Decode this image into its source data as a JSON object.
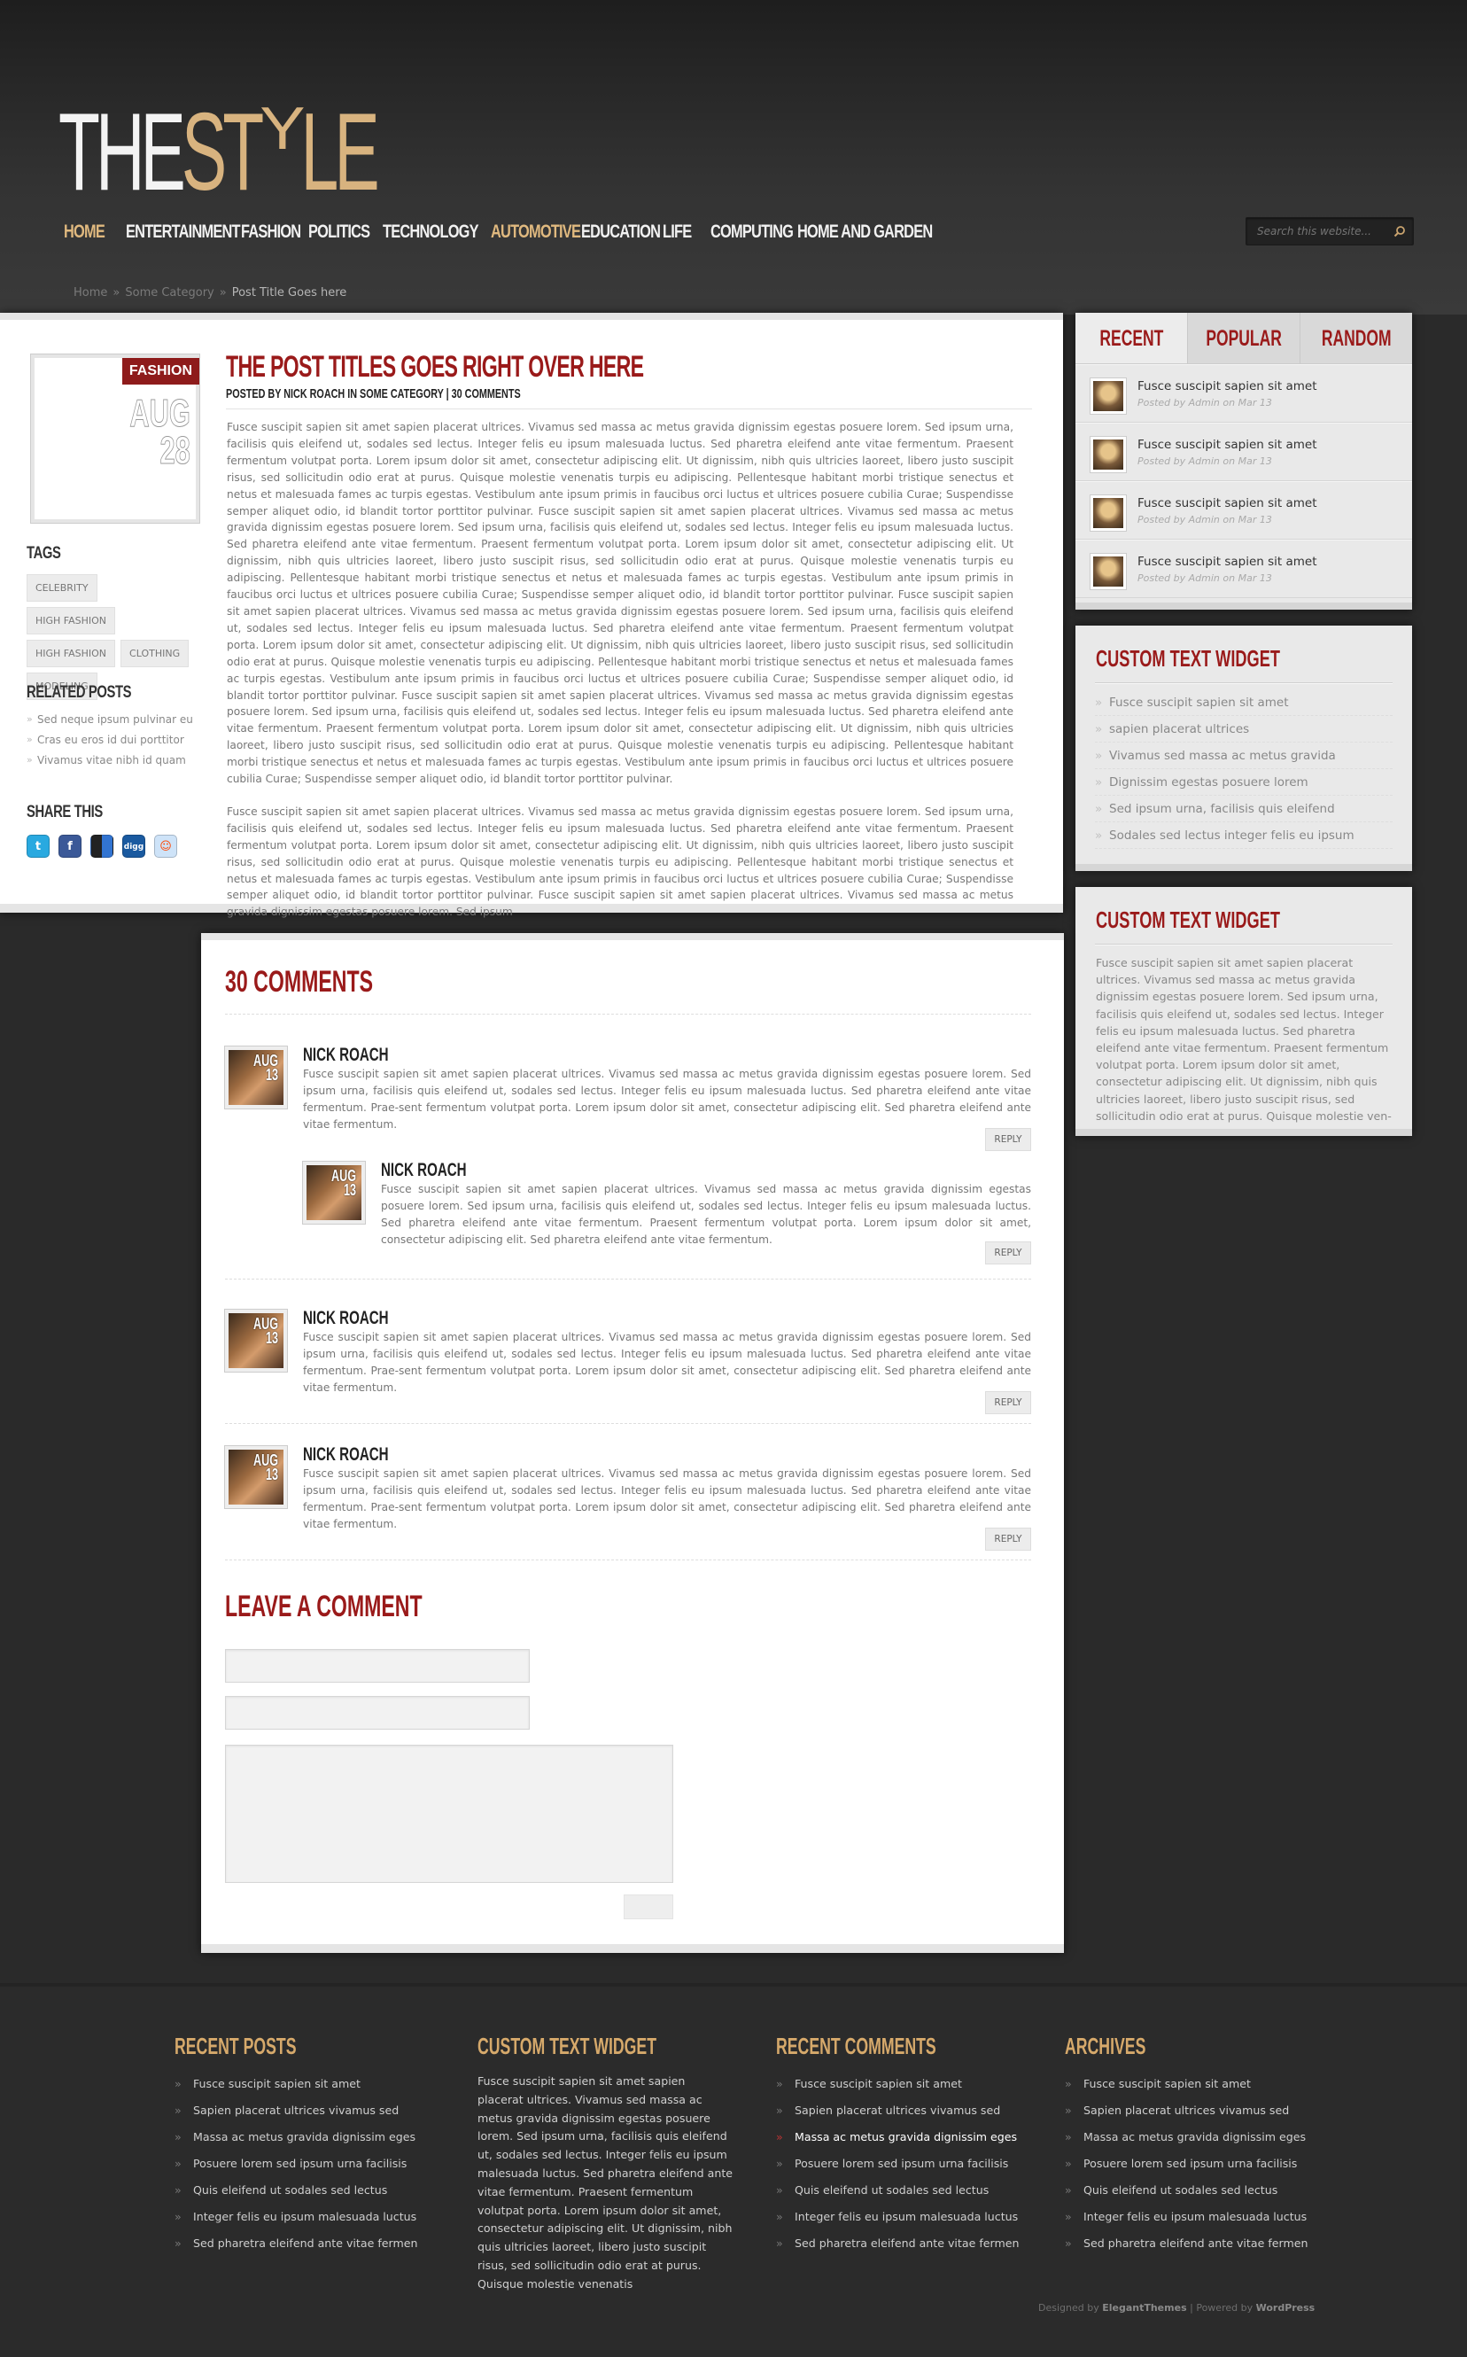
{
  "header": {
    "logo_part1": "THE",
    "logo_part2": "ST",
    "logo_part3": "Y",
    "logo_part4": "LE",
    "search_placeholder": "Search this website...",
    "nav": [
      {
        "label": "Home",
        "active": true
      },
      {
        "label": "Entertainment"
      },
      {
        "label": "Fashion"
      },
      {
        "label": "Politics"
      },
      {
        "label": "Technology"
      },
      {
        "label": "Automotive",
        "active": true
      },
      {
        "label": "Education"
      },
      {
        "label": "Life"
      },
      {
        "label": "Computing"
      },
      {
        "label": "Home and Garden"
      }
    ],
    "colors": {
      "gold": "#e0b97f",
      "red": "#9a1a1a"
    }
  },
  "breadcrumb": {
    "home": "Home",
    "category": "Some Category",
    "current": "Post Title Goes here",
    "sep": "»"
  },
  "post": {
    "category": "Fashion",
    "month": "AUG",
    "day": "28",
    "title": "The Post Titles Goes Right Over Here",
    "meta": "Posted by Nick Roach in Some Category | 30 Comments",
    "p1": "Fusce suscipit sapien sit amet sapien placerat ultrices. Vivamus sed massa ac metus gravida dignissim egestas posuere lorem. Sed ipsum urna, facilisis quis eleifend ut, sodales sed lectus. Integer felis eu ipsum malesuada luctus. Sed pharetra eleifend ante vitae fermentum. Praesent fermentum volutpat porta. Lorem ipsum dolor sit amet, consectetur adipiscing elit. Ut dignissim, nibh quis ultricies laoreet, libero justo suscipit risus, sed sollicitudin odio erat at purus. Quisque molestie venenatis turpis eu adipiscing. Pellentesque habitant morbi tristique senectus et netus et malesuada fames ac turpis egestas. Vestibulum ante ipsum primis in faucibus orci luctus et ultrices posuere cubilia Curae; Suspendisse semper aliquet odio, id blandit tortor porttitor pulvinar. Fusce suscipit sapien sit amet sapien placerat ultrices. Vivamus sed massa ac metus gravida dignissim egestas posuere lorem. Sed ipsum urna, facilisis quis eleifend ut, sodales sed lectus. Integer felis eu ipsum malesuada luctus. Sed pharetra eleifend ante vitae fermentum. Praesent fermentum volutpat porta. Lorem ipsum dolor sit amet, consectetur adipiscing elit. Ut dignissim, nibh quis ultricies laoreet, libero justo suscipit risus, sed sollicitudin odio erat at purus. Quisque molestie venenatis turpis eu adipiscing. Pellentesque habitant morbi tristique senectus et netus et malesuada fames ac turpis egestas. Vestibulum ante ipsum primis in faucibus orci luctus et ultrices posuere cubilia Curae; Suspendisse semper aliquet odio, id blandit tortor porttitor pulvinar. Fusce suscipit sapien sit amet sapien placerat ultrices. Vivamus sed massa ac metus gravida dignissim egestas posuere lorem. Sed ipsum urna, facilisis quis eleifend ut, sodales sed lectus. Integer felis eu ipsum malesuada luctus. Sed pharetra eleifend ante vitae fermentum. Praesent fermentum volutpat porta. Lorem ipsum dolor sit amet, consectetur adipiscing elit. Ut dignissim, nibh quis ultricies laoreet, libero justo suscipit risus, sed sollicitudin odio erat at purus. Quisque molestie venenatis turpis eu adipiscing. Pellentesque habitant morbi tristique senectus et netus et malesuada fames ac turpis egestas. Vestibulum ante ipsum primis in faucibus orci luctus et ultrices posuere cubilia Curae; Suspendisse semper aliquet odio, id blandit tortor porttitor pulvinar. Fusce suscipit sapien sit amet sapien placerat ultrices. Vivamus sed massa ac metus gravida dignissim egestas posuere lorem. Sed ipsum urna, facilisis quis eleifend ut, sodales sed lectus. Integer felis eu ipsum malesuada luctus. Sed pharetra eleifend ante vitae fermentum. Praesent fermentum volutpat porta. Lorem ipsum dolor sit amet, consectetur adipiscing elit. Ut dignissim, nibh quis ultricies laoreet, libero justo suscipit risus, sed sollicitudin odio erat at purus. Quisque molestie venenatis turpis eu adipiscing. Pellentesque habitant morbi tristique senectus et netus et malesuada fames ac turpis egestas. Vestibulum ante ipsum primis in faucibus orci luctus et ultrices posuere cubilia Curae; Suspendisse semper aliquet odio, id blandit tortor porttitor pulvinar.",
    "p2": "Fusce suscipit sapien sit amet sapien placerat ultrices. Vivamus sed massa ac metus gravida dignissim egestas posuere lorem. Sed ipsum urna, facilisis quis eleifend ut, sodales sed lectus. Integer felis eu ipsum malesuada luctus. Sed pharetra eleifend ante vitae fermentum. Praesent fermentum volutpat porta. Lorem ipsum dolor sit amet, consectetur adipiscing elit. Ut dignissim, nibh quis ultricies laoreet, libero justo suscipit risus, sed sollicitudin odio erat at purus. Quisque molestie venenatis turpis eu adipiscing. Pellentesque habitant morbi tristique senectus et netus et malesuada fames ac turpis egestas. Vestibulum ante ipsum primis in faucibus orci luctus et ultrices posuere cubilia Curae; Suspendisse semper aliquet odio, id blandit tortor porttitor pulvinar. Fusce suscipit sapien sit amet sapien placerat ultrices. Vivamus sed massa ac metus gravida dignissim egestas posuere lorem. Sed ipsum"
  },
  "left": {
    "tags_title": "Tags",
    "tags": [
      "Celebrity",
      "High Fashion",
      "High Fashion",
      "Clothing",
      "Modeling"
    ],
    "related_title": "Related Posts",
    "related": [
      "Sed neque ipsum pulvinar eu",
      "Cras eu eros id dui porttitor",
      "Vivamus vitae nibh id quam"
    ],
    "share_title": "Share This",
    "share_icons": [
      "twitter-icon",
      "facebook-icon",
      "delicious-icon",
      "digg-icon",
      "reddit-icon"
    ]
  },
  "sidebar": {
    "tabs": [
      "Recent",
      "Popular",
      "Random"
    ],
    "recent": [
      {
        "title": "Fusce suscipit sapien sit amet",
        "meta": "Posted by Admin on Mar 13"
      },
      {
        "title": "Fusce suscipit sapien sit amet",
        "meta": "Posted by Admin on Mar 13"
      },
      {
        "title": "Fusce suscipit sapien sit amet",
        "meta": "Posted by Admin on Mar 13"
      },
      {
        "title": "Fusce suscipit sapien sit amet",
        "meta": "Posted by Admin on Mar 13"
      }
    ],
    "widget1_title": "Custom Text Widget",
    "widget1_items": [
      "Fusce suscipit sapien sit amet",
      "sapien placerat ultrices",
      "Vivamus sed massa ac metus gravida",
      "Dignissim egestas posuere lorem",
      "Sed ipsum urna, facilisis quis eleifend",
      "Sodales sed lectus integer felis eu ipsum"
    ],
    "widget2_title": "Custom Text Widget",
    "widget2_text": "Fusce suscipit sapien sit amet sapien placerat ultrices. Vivamus sed massa ac metus gravida dignissim egestas posuere lorem. Sed ipsum urna, facilisis quis eleifend ut, sodales sed lectus. Integer felis eu ipsum malesuada luctus. Sed pharetra eleifend ante vitae fermentum. Praesent fermentum volutpat porta. Lorem ipsum dolor sit amet, consectetur adipiscing elit. Ut dignissim, nibh quis ultricies laoreet, libero justo suscipit risus, sed sollicitudin odio erat at purus. Quisque molestie ven-"
  },
  "comments": {
    "title": "30 Comments",
    "items": [
      {
        "name": "Nick Roach",
        "month": "AUG",
        "day": "13",
        "reply": "Reply",
        "text": "Fusce suscipit sapien sit amet sapien placerat ultrices. Vivamus sed massa ac metus gravida dignissim egestas posuere lorem. Sed ipsum urna, facilisis quis eleifend ut, sodales sed lectus. Integer felis eu ipsum malesuada luctus. Sed pharetra eleifend ante vitae fermentum. Prae-sent fermentum volutpat porta. Lorem ipsum dolor sit amet, consectetur adipiscing elit. Sed pharetra eleifend ante vitae fermentum."
      },
      {
        "name": "Nick Roach",
        "month": "AUG",
        "day": "13",
        "reply": "Reply",
        "text": "Fusce suscipit sapien sit amet sapien placerat ultrices. Vivamus sed massa ac metus gravida dignissim egestas posuere lorem. Sed ipsum urna, facilisis quis eleifend ut, sodales sed lectus. Integer felis eu ipsum malesuada luctus. Sed pharetra eleifend ante vitae fermentum. Praesent fermentum volutpat porta. Lorem ipsum dolor sit amet, consectetur adipiscing elit. Sed pharetra eleifend ante vitae fermentum."
      },
      {
        "name": "Nick Roach",
        "month": "AUG",
        "day": "13",
        "reply": "Reply",
        "text": "Fusce suscipit sapien sit amet sapien placerat ultrices. Vivamus sed massa ac metus gravida dignissim egestas posuere lorem. Sed ipsum urna, facilisis quis eleifend ut, sodales sed lectus. Integer felis eu ipsum malesuada luctus. Sed pharetra eleifend ante vitae fermentum. Prae-sent fermentum volutpat porta. Lorem ipsum dolor sit amet, consectetur adipiscing elit. Sed pharetra eleifend ante vitae fermentum."
      },
      {
        "name": "Nick Roach",
        "month": "AUG",
        "day": "13",
        "reply": "Reply",
        "text": "Fusce suscipit sapien sit amet sapien placerat ultrices. Vivamus sed massa ac metus gravida dignissim egestas posuere lorem. Sed ipsum urna, facilisis quis eleifend ut, sodales sed lectus. Integer felis eu ipsum malesuada luctus. Sed pharetra eleifend ante vitae fermentum. Prae-sent fermentum volutpat porta. Lorem ipsum dolor sit amet, consectetur adipiscing elit. Sed pharetra eleifend ante vitae fermentum."
      }
    ],
    "leave_title": "Leave a Comment"
  },
  "footer": {
    "col1_title": "Recent Posts",
    "col1": [
      "Fusce suscipit sapien sit amet",
      "Sapien placerat ultrices vivamus sed",
      "Massa ac metus gravida dignissim eges",
      "Posuere lorem sed ipsum urna facilisis",
      "Quis eleifend ut sodales sed lectus",
      "Integer felis eu ipsum malesuada luctus",
      "Sed pharetra eleifend ante vitae fermen"
    ],
    "col2_title": "Custom Text Widget",
    "col2_text": "Fusce suscipit sapien sit amet sapien placerat ultrices. Vivamus sed massa ac metus gravida dignissim egestas posuere lorem. Sed ipsum urna, facilisis quis eleifend ut, sodales sed lectus. Integer felis eu ipsum malesuada luctus. Sed pharetra eleifend ante vitae fermentum. Praesent fermentum volutpat porta. Lorem ipsum dolor sit amet, consectetur adipiscing elit. Ut dignissim, nibh quis ultricies laoreet, libero justo suscipit risus, sed sollicitudin odio erat at purus. Quisque molestie venenatis",
    "col3_title": "Recent Comments",
    "col3": [
      "Fusce suscipit sapien sit amet",
      "Sapien placerat ultrices vivamus sed",
      "Massa ac metus gravida dignissim eges",
      "Posuere lorem sed ipsum urna facilisis",
      "Quis eleifend ut sodales sed lectus",
      "Integer felis eu ipsum malesuada luctus",
      "Sed pharetra eleifend ante vitae fermen"
    ],
    "col4_title": "Archives",
    "col4": [
      "Fusce suscipit sapien sit amet",
      "Sapien placerat ultrices vivamus sed",
      "Massa ac metus gravida dignissim eges",
      "Posuere lorem sed ipsum urna facilisis",
      "Quis eleifend ut sodales sed lectus",
      "Integer felis eu ipsum malesuada luctus",
      "Sed pharetra eleifend ante vitae fermen"
    ],
    "credits_prefix": "Designed by",
    "credits_brand": "ElegantThemes",
    "credits_mid": "| Powered by",
    "credits_wp": "WordPress"
  }
}
